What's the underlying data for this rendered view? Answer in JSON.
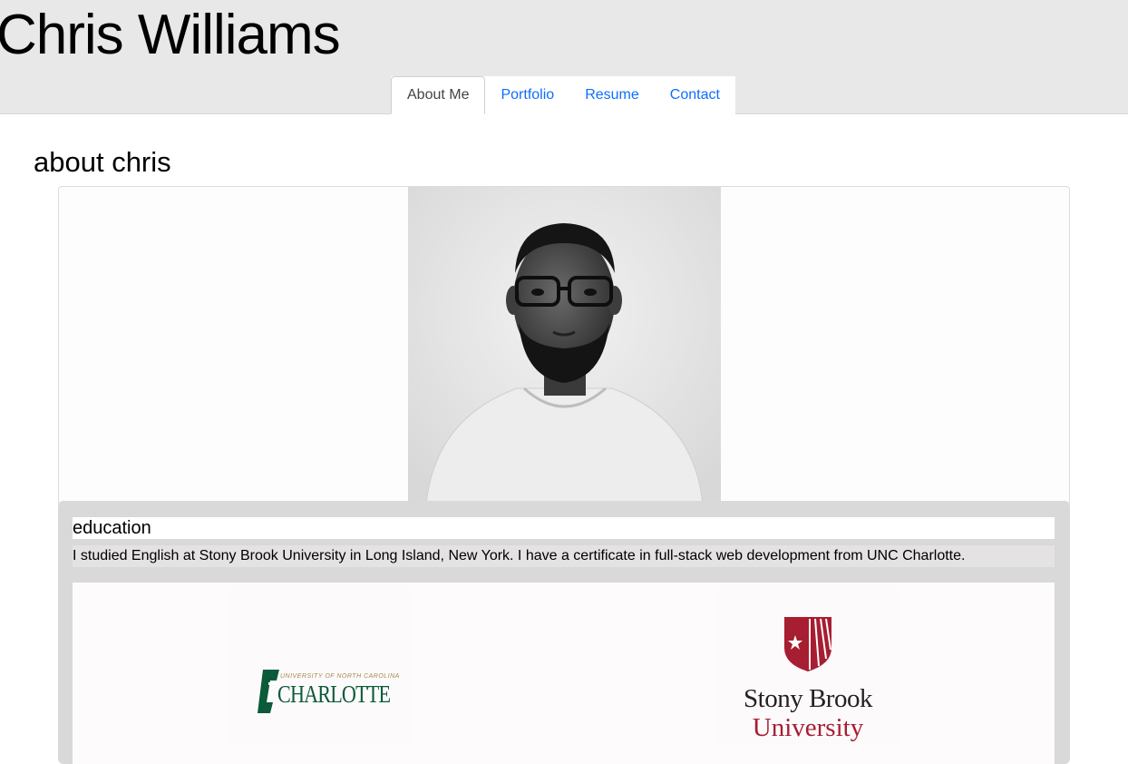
{
  "header": {
    "site_title": "Chris Williams",
    "nav": [
      {
        "label": "About Me",
        "active": true
      },
      {
        "label": "Portfolio",
        "active": false
      },
      {
        "label": "Resume",
        "active": false
      },
      {
        "label": "Contact",
        "active": false
      }
    ]
  },
  "main": {
    "section_title": "about chris",
    "education": {
      "heading": "education",
      "text": "I studied English at Stony Brook University in Long Island, New York. I have a certificate in full-stack web development from UNC Charlotte.",
      "logos": {
        "unc": {
          "small": "UNIVERSITY OF NORTH CAROLINA",
          "big": "CHARLOTTE"
        },
        "sbu": {
          "line1": "Stony Brook",
          "line2": "University"
        }
      }
    }
  },
  "colors": {
    "header_bg": "#e8e8e8",
    "link": "#0d6efd",
    "unc_green": "#0b5a3a",
    "unc_gold": "#a48a4a",
    "sbu_red": "#a71d31"
  }
}
